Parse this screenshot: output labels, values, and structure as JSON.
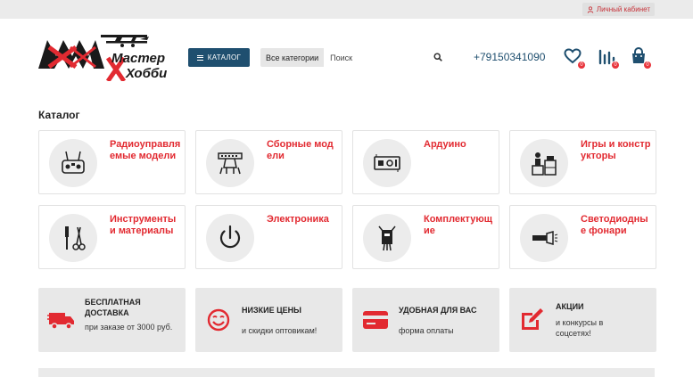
{
  "topbar": {
    "account_label": "Личный кабинет"
  },
  "header": {
    "logo_text_1": "Мастер",
    "logo_text_2": "Хобби",
    "catalog_button": "КАТАЛОГ",
    "search_category": "Все категории",
    "search_placeholder": "Поиск",
    "phone": "+79150341090",
    "wishlist_count": "0",
    "compare_count": "0",
    "cart_count": "0"
  },
  "catalog": {
    "title": "Каталог",
    "categories": [
      {
        "label": "Радиоуправляемые модели",
        "icon": "rc-controller-icon"
      },
      {
        "label": "Сборные модели",
        "icon": "model-kit-icon"
      },
      {
        "label": "Ардуино",
        "icon": "arduino-board-icon"
      },
      {
        "label": "Игры и конструкторы",
        "icon": "toys-icon"
      },
      {
        "label": "Инструменты и материалы",
        "icon": "tools-icon"
      },
      {
        "label": "Электроника",
        "icon": "power-icon"
      },
      {
        "label": "Комплектующие",
        "icon": "components-icon"
      },
      {
        "label": "Светодиодные фонари",
        "icon": "flashlight-icon"
      }
    ]
  },
  "features": [
    {
      "title": "БЕСПЛАТНАЯ ДОСТАВКА",
      "subtitle": "при заказе от 3000 руб.",
      "icon": "delivery-truck-icon"
    },
    {
      "title": "НИЗКИЕ ЦЕНЫ",
      "subtitle": "и скидки оптовикам!",
      "icon": "smile-icon"
    },
    {
      "title": "УДОБНАЯ ДЛЯ ВАС",
      "subtitle": "форма оплаты",
      "icon": "credit-card-icon"
    },
    {
      "title": "АКЦИИ",
      "subtitle": "и конкурсы в соцсетях!",
      "icon": "edit-icon"
    }
  ],
  "colors": {
    "accent": "#e22a31",
    "brand": "#1f4f6f"
  }
}
